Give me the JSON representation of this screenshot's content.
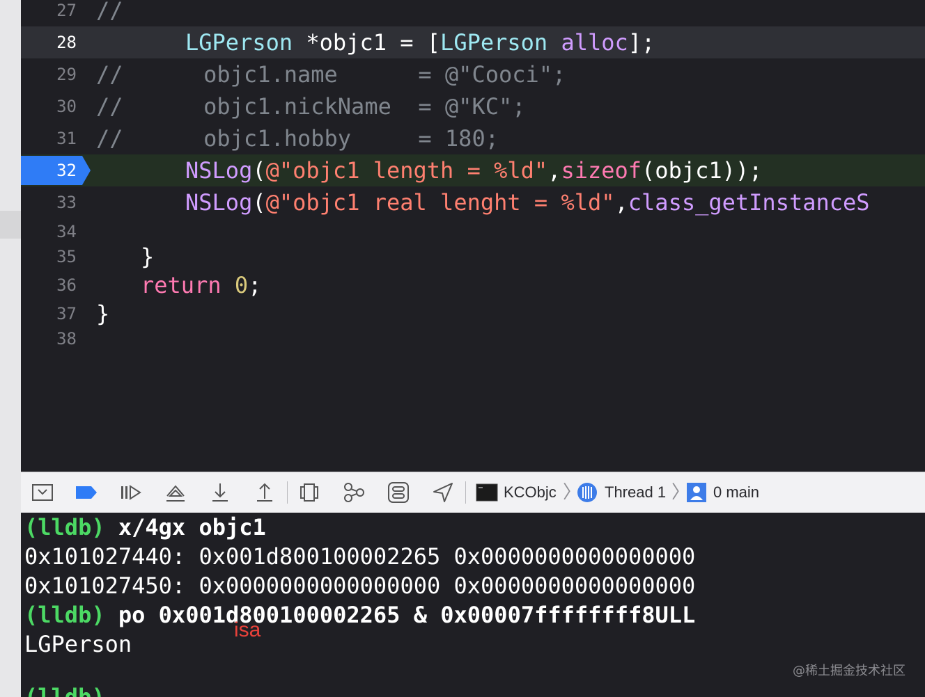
{
  "editor": {
    "lines": [
      {
        "num": "27",
        "tokens": [
          {
            "t": "//",
            "c": "comment"
          }
        ]
      },
      {
        "num": "28",
        "tokens": [
          {
            "t": "LGPerson",
            "c": "cls"
          },
          {
            "t": " *objc1 = [",
            "c": "var"
          },
          {
            "t": "LGPerson",
            "c": "cls"
          },
          {
            "t": " ",
            "c": "var"
          },
          {
            "t": "alloc",
            "c": "fn"
          },
          {
            "t": "];",
            "c": "var"
          }
        ]
      },
      {
        "num": "29",
        "tokens": [
          {
            "t": "//",
            "c": "comment"
          },
          {
            "t": "      objc1.name      = @\"Cooci\";",
            "c": "comment"
          }
        ]
      },
      {
        "num": "30",
        "tokens": [
          {
            "t": "//",
            "c": "comment"
          },
          {
            "t": "      objc1.nickName  = @\"KC\";",
            "c": "comment"
          }
        ]
      },
      {
        "num": "31",
        "tokens": [
          {
            "t": "//",
            "c": "comment"
          },
          {
            "t": "      objc1.hobby     = 180;",
            "c": "comment"
          }
        ]
      },
      {
        "num": "32",
        "tokens": [
          {
            "t": "NSLog",
            "c": "fn"
          },
          {
            "t": "(",
            "c": "var"
          },
          {
            "t": "@\"objc1 length = %ld\"",
            "c": "str"
          },
          {
            "t": ",",
            "c": "var"
          },
          {
            "t": "sizeof",
            "c": "kw"
          },
          {
            "t": "(objc1));",
            "c": "var"
          }
        ]
      },
      {
        "num": "33",
        "tokens": [
          {
            "t": "NSLog",
            "c": "fn"
          },
          {
            "t": "(",
            "c": "var"
          },
          {
            "t": "@\"objc1 real lenght = %ld\"",
            "c": "str"
          },
          {
            "t": ",",
            "c": "var"
          },
          {
            "t": "class_getInstanceS",
            "c": "fn"
          }
        ]
      },
      {
        "num": "34",
        "tokens": []
      },
      {
        "num": "35",
        "tokens": [
          {
            "t": "}",
            "c": "var"
          }
        ]
      },
      {
        "num": "36",
        "tokens": [
          {
            "t": "return",
            "c": "kw"
          },
          {
            "t": " ",
            "c": "var"
          },
          {
            "t": "0",
            "c": "num"
          },
          {
            "t": ";",
            "c": "var"
          }
        ]
      },
      {
        "num": "37",
        "tokens": [
          {
            "t": "}",
            "c": "var"
          }
        ]
      },
      {
        "num": "38",
        "tokens": []
      }
    ]
  },
  "debug_bar": {
    "target": "KCObjc",
    "thread": "Thread 1",
    "frame": "0 main"
  },
  "console": {
    "prompt": "(lldb)",
    "cmd1": " x/4gx objc1",
    "mem1": "0x101027440: 0x001d800100002265 0x0000000000000000",
    "mem2": "0x101027450: 0x0000000000000000 0x0000000000000000",
    "cmd2": " po 0x001d800100002265 & 0x00007ffffffff8ULL",
    "output": "LGPerson",
    "prompt_cut": "(lldb)"
  },
  "annotation": "isa",
  "watermark": "@稀土掘金技术社区"
}
